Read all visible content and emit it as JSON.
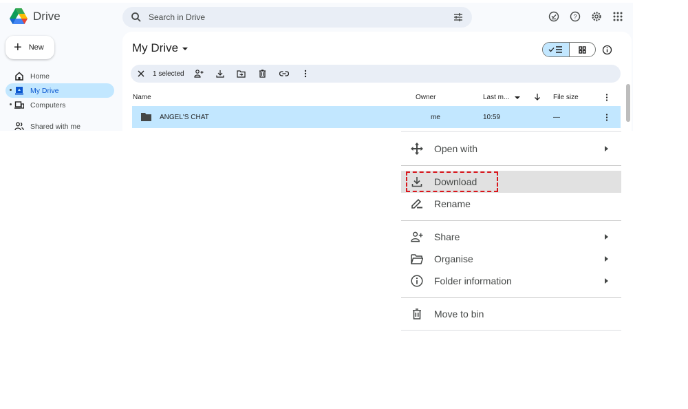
{
  "header": {
    "app_name": "Drive",
    "search_placeholder": "Search in Drive",
    "icons": [
      "ready-for-offline-icon",
      "help-icon",
      "settings-icon",
      "apps-grid-icon"
    ]
  },
  "sidebar": {
    "new_label": "New",
    "items": [
      {
        "label": "Home",
        "icon": "home-icon",
        "active": false
      },
      {
        "label": "My Drive",
        "icon": "my-drive-icon",
        "active": true
      },
      {
        "label": "Computers",
        "icon": "computers-icon",
        "active": false
      },
      {
        "label": "Shared with me",
        "icon": "shared-icon",
        "active": false
      }
    ]
  },
  "main": {
    "title": "My Drive",
    "view_mode": "list",
    "selection_bar": {
      "count_label": "1 selected",
      "actions": [
        "close",
        "share",
        "download",
        "move",
        "delete",
        "copy-link",
        "more"
      ]
    },
    "columns": {
      "name": "Name",
      "owner": "Owner",
      "last_modified": "Last m...",
      "file_size": "File size"
    },
    "rows": [
      {
        "name": "ANGEL'S CHAT",
        "owner": "me",
        "last_modified": "10:59",
        "file_size": "—",
        "selected": true
      }
    ]
  },
  "context_menu": {
    "items": [
      {
        "label": "Open with",
        "icon": "open-with-icon",
        "submenu": true
      },
      {
        "label": "Download",
        "icon": "download-icon",
        "submenu": false,
        "highlighted": true
      },
      {
        "label": "Rename",
        "icon": "rename-icon",
        "submenu": false
      },
      {
        "label": "Share",
        "icon": "share-icon",
        "submenu": true
      },
      {
        "label": "Organise",
        "icon": "organise-icon",
        "submenu": true
      },
      {
        "label": "Folder information",
        "icon": "info-icon",
        "submenu": true
      },
      {
        "label": "Move to bin",
        "icon": "bin-icon",
        "submenu": false
      }
    ],
    "highlight_color": "#d9161c"
  },
  "colors": {
    "accent": "#0b57d0",
    "selected_bg": "#c2e7ff",
    "surface": "#f8fafd"
  }
}
